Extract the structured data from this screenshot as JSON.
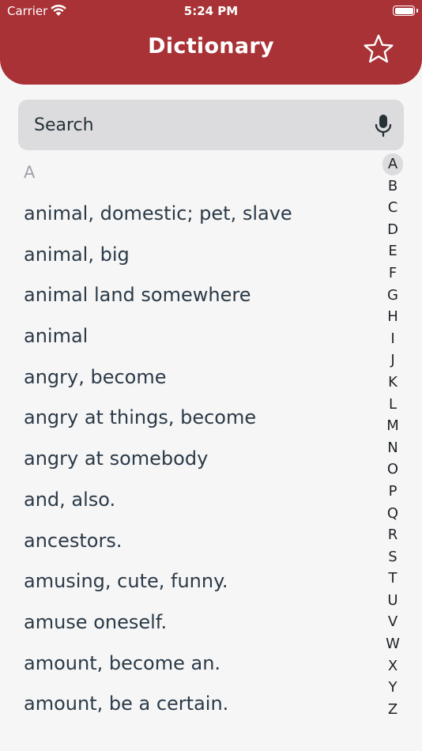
{
  "status_bar": {
    "carrier": "Carrier",
    "time": "5:24 PM"
  },
  "header": {
    "title": "Dictionary",
    "favorite_icon": "star-outline-icon"
  },
  "search": {
    "placeholder": "Search",
    "value": "",
    "mic_icon": "microphone-icon"
  },
  "section": {
    "letter": "A"
  },
  "words": [
    "animal, domestic; pet, slave",
    "animal, big",
    "animal land somewhere",
    "animal",
    "angry, become",
    "angry at things, become",
    "angry at somebody",
    "and, also.",
    "ancestors.",
    "amusing, cute, funny.",
    "amuse oneself.",
    "amount, become an.",
    "amount, be a certain."
  ],
  "index": {
    "active": "A",
    "letters": [
      "A",
      "B",
      "C",
      "D",
      "E",
      "F",
      "G",
      "H",
      "I",
      "J",
      "K",
      "L",
      "M",
      "N",
      "O",
      "P",
      "Q",
      "R",
      "S",
      "T",
      "U",
      "V",
      "W",
      "X",
      "Y",
      "Z"
    ]
  },
  "colors": {
    "brand": "#a83236",
    "search_bg": "#dcdcde",
    "text": "#2b3a48",
    "section_text": "#9ea2a6"
  }
}
